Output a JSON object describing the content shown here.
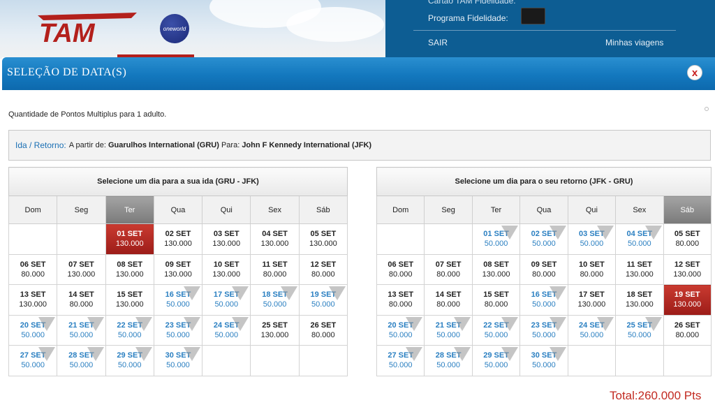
{
  "header": {
    "brand": "TAM",
    "alliance": "oneworld",
    "account_cutoff": "Cartão TAM Fidelidade:",
    "fidelity_label": "Programa Fidelidade:",
    "logout": "SAIR",
    "my_trips": "Minhas viagens"
  },
  "modal": {
    "title": "SELEÇÃO DE DATA(S)",
    "close_label": "x",
    "points_note": "Quantidade de Pontos Multiplus para 1 adulto.",
    "route": {
      "type": "Ida / Retorno:",
      "from_label": "A partir de:",
      "from": "Guarulhos International (GRU)",
      "to_label": "Para:",
      "to": "John F Kennedy International (JFK)"
    },
    "days": [
      "Dom",
      "Seg",
      "Ter",
      "Qua",
      "Qui",
      "Sex",
      "Sáb"
    ],
    "outbound": {
      "title": "Selecione um dia para a sua ida (GRU - JFK)",
      "active_day": 2,
      "weeks": [
        [
          null,
          null,
          {
            "d": "01 SET",
            "p": "130.000",
            "s": "selected"
          },
          {
            "d": "02 SET",
            "p": "130.000"
          },
          {
            "d": "03 SET",
            "p": "130.000"
          },
          {
            "d": "04 SET",
            "p": "130.000"
          },
          {
            "d": "05 SET",
            "p": "130.000"
          }
        ],
        [
          {
            "d": "06 SET",
            "p": "80.000"
          },
          {
            "d": "07 SET",
            "p": "130.000"
          },
          {
            "d": "08 SET",
            "p": "130.000"
          },
          {
            "d": "09 SET",
            "p": "130.000"
          },
          {
            "d": "10 SET",
            "p": "130.000"
          },
          {
            "d": "11 SET",
            "p": "80.000"
          },
          {
            "d": "12 SET",
            "p": "80.000"
          }
        ],
        [
          {
            "d": "13 SET",
            "p": "130.000"
          },
          {
            "d": "14 SET",
            "p": "80.000"
          },
          {
            "d": "15 SET",
            "p": "130.000"
          },
          {
            "d": "16 SET",
            "p": "50.000",
            "s": "promo"
          },
          {
            "d": "17 SET",
            "p": "50.000",
            "s": "promo"
          },
          {
            "d": "18 SET",
            "p": "50.000",
            "s": "promo"
          },
          {
            "d": "19 SET",
            "p": "50.000",
            "s": "promo"
          }
        ],
        [
          {
            "d": "20 SET",
            "p": "50.000",
            "s": "promo"
          },
          {
            "d": "21 SET",
            "p": "50.000",
            "s": "promo"
          },
          {
            "d": "22 SET",
            "p": "50.000",
            "s": "promo"
          },
          {
            "d": "23 SET",
            "p": "50.000",
            "s": "promo"
          },
          {
            "d": "24 SET",
            "p": "50.000",
            "s": "promo"
          },
          {
            "d": "25 SET",
            "p": "130.000"
          },
          {
            "d": "26 SET",
            "p": "80.000"
          }
        ],
        [
          {
            "d": "27 SET",
            "p": "50.000",
            "s": "promo"
          },
          {
            "d": "28 SET",
            "p": "50.000",
            "s": "promo"
          },
          {
            "d": "29 SET",
            "p": "50.000",
            "s": "promo"
          },
          {
            "d": "30 SET",
            "p": "50.000",
            "s": "promo"
          },
          null,
          null,
          null
        ]
      ]
    },
    "inbound": {
      "title": "Selecione um dia para o seu retorno (JFK - GRU)",
      "active_day": 6,
      "weeks": [
        [
          null,
          null,
          {
            "d": "01 SET",
            "p": "50.000",
            "s": "promo"
          },
          {
            "d": "02 SET",
            "p": "50.000",
            "s": "promo"
          },
          {
            "d": "03 SET",
            "p": "50.000",
            "s": "promo"
          },
          {
            "d": "04 SET",
            "p": "50.000",
            "s": "promo"
          },
          {
            "d": "05 SET",
            "p": "80.000"
          }
        ],
        [
          {
            "d": "06 SET",
            "p": "80.000"
          },
          {
            "d": "07 SET",
            "p": "80.000"
          },
          {
            "d": "08 SET",
            "p": "130.000"
          },
          {
            "d": "09 SET",
            "p": "80.000"
          },
          {
            "d": "10 SET",
            "p": "80.000"
          },
          {
            "d": "11 SET",
            "p": "130.000"
          },
          {
            "d": "12 SET",
            "p": "130.000"
          }
        ],
        [
          {
            "d": "13 SET",
            "p": "80.000"
          },
          {
            "d": "14 SET",
            "p": "80.000"
          },
          {
            "d": "15 SET",
            "p": "80.000"
          },
          {
            "d": "16 SET",
            "p": "50.000",
            "s": "promo"
          },
          {
            "d": "17 SET",
            "p": "130.000"
          },
          {
            "d": "18 SET",
            "p": "130.000"
          },
          {
            "d": "19 SET",
            "p": "130.000",
            "s": "selected"
          }
        ],
        [
          {
            "d": "20 SET",
            "p": "50.000",
            "s": "promo"
          },
          {
            "d": "21 SET",
            "p": "50.000",
            "s": "promo"
          },
          {
            "d": "22 SET",
            "p": "50.000",
            "s": "promo"
          },
          {
            "d": "23 SET",
            "p": "50.000",
            "s": "promo"
          },
          {
            "d": "24 SET",
            "p": "50.000",
            "s": "promo"
          },
          {
            "d": "25 SET",
            "p": "50.000",
            "s": "promo"
          },
          {
            "d": "26 SET",
            "p": "80.000"
          }
        ],
        [
          {
            "d": "27 SET",
            "p": "50.000",
            "s": "promo"
          },
          {
            "d": "28 SET",
            "p": "50.000",
            "s": "promo"
          },
          {
            "d": "29 SET",
            "p": "50.000",
            "s": "promo"
          },
          {
            "d": "30 SET",
            "p": "50.000",
            "s": "promo"
          },
          null,
          null,
          null
        ]
      ]
    },
    "total": "Total:260.000 Pts"
  },
  "colors": {
    "brand_blue": "#1378be",
    "selected_red": "#b3261e",
    "promo_blue": "#2a7fc1"
  }
}
